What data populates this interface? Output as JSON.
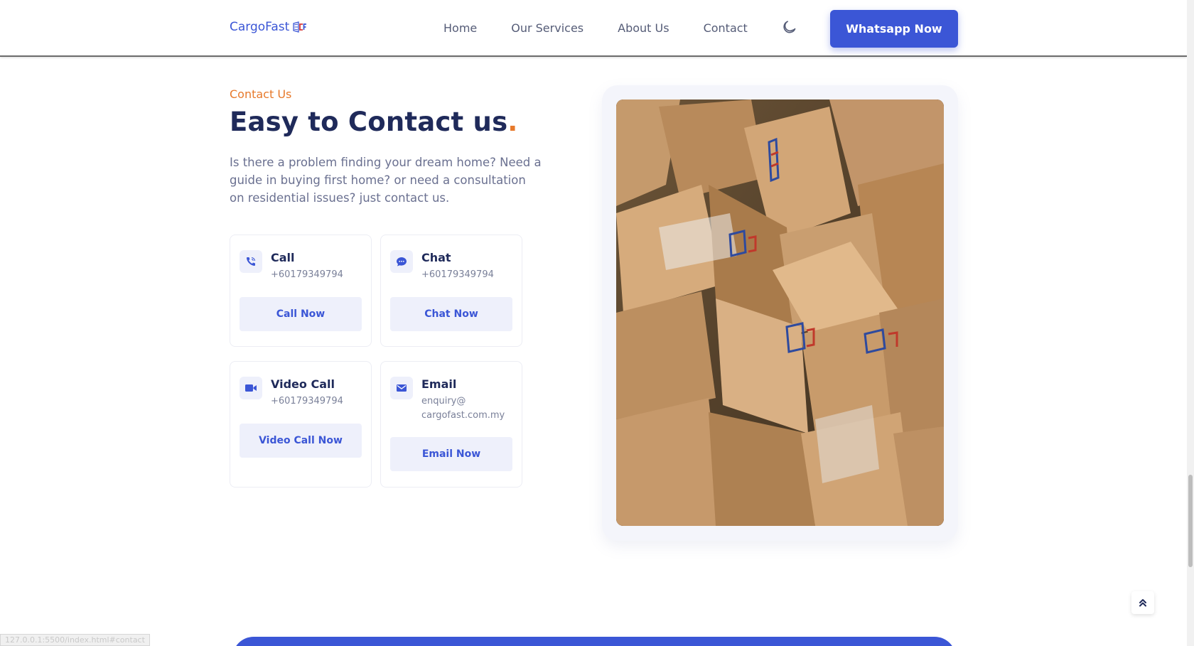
{
  "header": {
    "logo_text": "CargoFast",
    "nav": [
      "Home",
      "Our Services",
      "About Us",
      "Contact"
    ],
    "theme_icon": "moon-icon",
    "cta_label": "Whatsapp Now"
  },
  "contact": {
    "eyebrow": "Contact Us",
    "title": "Easy to Contact us",
    "title_accent": ".",
    "description": "Is there a problem finding your dream home? Need a guide in buying first home? or need a consultation on residential issues? just contact us.",
    "cards": [
      {
        "title": "Call",
        "value": "+60179349794",
        "button": "Call Now",
        "icon": "phone-icon"
      },
      {
        "title": "Chat",
        "value": "+60179349794",
        "button": "Chat Now",
        "icon": "chat-bubble-icon"
      },
      {
        "title": "Video Call",
        "value": "+60179349794",
        "button": "Video Call Now",
        "icon": "video-camera-icon"
      },
      {
        "title": "Email",
        "value": "enquiry@ cargofast.com.my",
        "button": "Email Now",
        "icon": "envelope-icon"
      }
    ]
  },
  "status_url": "127.0.0.1:5500/index.html#contact",
  "colors": {
    "brand_blue": "#3b56d6",
    "accent_orange": "#e7792b",
    "heading": "#1f2a5a",
    "soft_blue_bg": "#eef0fb"
  }
}
